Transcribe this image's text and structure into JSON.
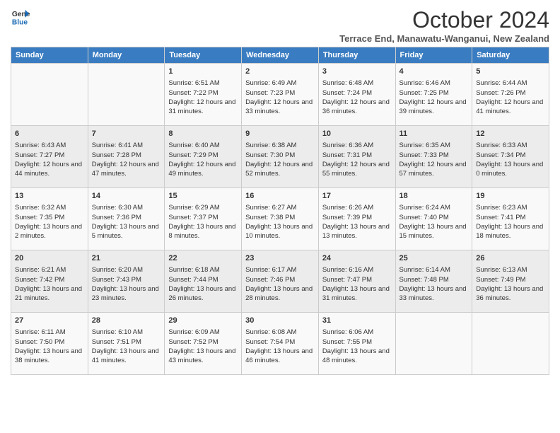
{
  "header": {
    "logo_line1": "General",
    "logo_line2": "Blue",
    "title": "October 2024",
    "subtitle": "Terrace End, Manawatu-Wanganui, New Zealand"
  },
  "days_of_week": [
    "Sunday",
    "Monday",
    "Tuesday",
    "Wednesday",
    "Thursday",
    "Friday",
    "Saturday"
  ],
  "weeks": [
    [
      {
        "day": "",
        "info": ""
      },
      {
        "day": "",
        "info": ""
      },
      {
        "day": "1",
        "info": "Sunrise: 6:51 AM\nSunset: 7:22 PM\nDaylight: 12 hours and 31 minutes."
      },
      {
        "day": "2",
        "info": "Sunrise: 6:49 AM\nSunset: 7:23 PM\nDaylight: 12 hours and 33 minutes."
      },
      {
        "day": "3",
        "info": "Sunrise: 6:48 AM\nSunset: 7:24 PM\nDaylight: 12 hours and 36 minutes."
      },
      {
        "day": "4",
        "info": "Sunrise: 6:46 AM\nSunset: 7:25 PM\nDaylight: 12 hours and 39 minutes."
      },
      {
        "day": "5",
        "info": "Sunrise: 6:44 AM\nSunset: 7:26 PM\nDaylight: 12 hours and 41 minutes."
      }
    ],
    [
      {
        "day": "6",
        "info": "Sunrise: 6:43 AM\nSunset: 7:27 PM\nDaylight: 12 hours and 44 minutes."
      },
      {
        "day": "7",
        "info": "Sunrise: 6:41 AM\nSunset: 7:28 PM\nDaylight: 12 hours and 47 minutes."
      },
      {
        "day": "8",
        "info": "Sunrise: 6:40 AM\nSunset: 7:29 PM\nDaylight: 12 hours and 49 minutes."
      },
      {
        "day": "9",
        "info": "Sunrise: 6:38 AM\nSunset: 7:30 PM\nDaylight: 12 hours and 52 minutes."
      },
      {
        "day": "10",
        "info": "Sunrise: 6:36 AM\nSunset: 7:31 PM\nDaylight: 12 hours and 55 minutes."
      },
      {
        "day": "11",
        "info": "Sunrise: 6:35 AM\nSunset: 7:33 PM\nDaylight: 12 hours and 57 minutes."
      },
      {
        "day": "12",
        "info": "Sunrise: 6:33 AM\nSunset: 7:34 PM\nDaylight: 13 hours and 0 minutes."
      }
    ],
    [
      {
        "day": "13",
        "info": "Sunrise: 6:32 AM\nSunset: 7:35 PM\nDaylight: 13 hours and 2 minutes."
      },
      {
        "day": "14",
        "info": "Sunrise: 6:30 AM\nSunset: 7:36 PM\nDaylight: 13 hours and 5 minutes."
      },
      {
        "day": "15",
        "info": "Sunrise: 6:29 AM\nSunset: 7:37 PM\nDaylight: 13 hours and 8 minutes."
      },
      {
        "day": "16",
        "info": "Sunrise: 6:27 AM\nSunset: 7:38 PM\nDaylight: 13 hours and 10 minutes."
      },
      {
        "day": "17",
        "info": "Sunrise: 6:26 AM\nSunset: 7:39 PM\nDaylight: 13 hours and 13 minutes."
      },
      {
        "day": "18",
        "info": "Sunrise: 6:24 AM\nSunset: 7:40 PM\nDaylight: 13 hours and 15 minutes."
      },
      {
        "day": "19",
        "info": "Sunrise: 6:23 AM\nSunset: 7:41 PM\nDaylight: 13 hours and 18 minutes."
      }
    ],
    [
      {
        "day": "20",
        "info": "Sunrise: 6:21 AM\nSunset: 7:42 PM\nDaylight: 13 hours and 21 minutes."
      },
      {
        "day": "21",
        "info": "Sunrise: 6:20 AM\nSunset: 7:43 PM\nDaylight: 13 hours and 23 minutes."
      },
      {
        "day": "22",
        "info": "Sunrise: 6:18 AM\nSunset: 7:44 PM\nDaylight: 13 hours and 26 minutes."
      },
      {
        "day": "23",
        "info": "Sunrise: 6:17 AM\nSunset: 7:46 PM\nDaylight: 13 hours and 28 minutes."
      },
      {
        "day": "24",
        "info": "Sunrise: 6:16 AM\nSunset: 7:47 PM\nDaylight: 13 hours and 31 minutes."
      },
      {
        "day": "25",
        "info": "Sunrise: 6:14 AM\nSunset: 7:48 PM\nDaylight: 13 hours and 33 minutes."
      },
      {
        "day": "26",
        "info": "Sunrise: 6:13 AM\nSunset: 7:49 PM\nDaylight: 13 hours and 36 minutes."
      }
    ],
    [
      {
        "day": "27",
        "info": "Sunrise: 6:11 AM\nSunset: 7:50 PM\nDaylight: 13 hours and 38 minutes."
      },
      {
        "day": "28",
        "info": "Sunrise: 6:10 AM\nSunset: 7:51 PM\nDaylight: 13 hours and 41 minutes."
      },
      {
        "day": "29",
        "info": "Sunrise: 6:09 AM\nSunset: 7:52 PM\nDaylight: 13 hours and 43 minutes."
      },
      {
        "day": "30",
        "info": "Sunrise: 6:08 AM\nSunset: 7:54 PM\nDaylight: 13 hours and 46 minutes."
      },
      {
        "day": "31",
        "info": "Sunrise: 6:06 AM\nSunset: 7:55 PM\nDaylight: 13 hours and 48 minutes."
      },
      {
        "day": "",
        "info": ""
      },
      {
        "day": "",
        "info": ""
      }
    ]
  ]
}
